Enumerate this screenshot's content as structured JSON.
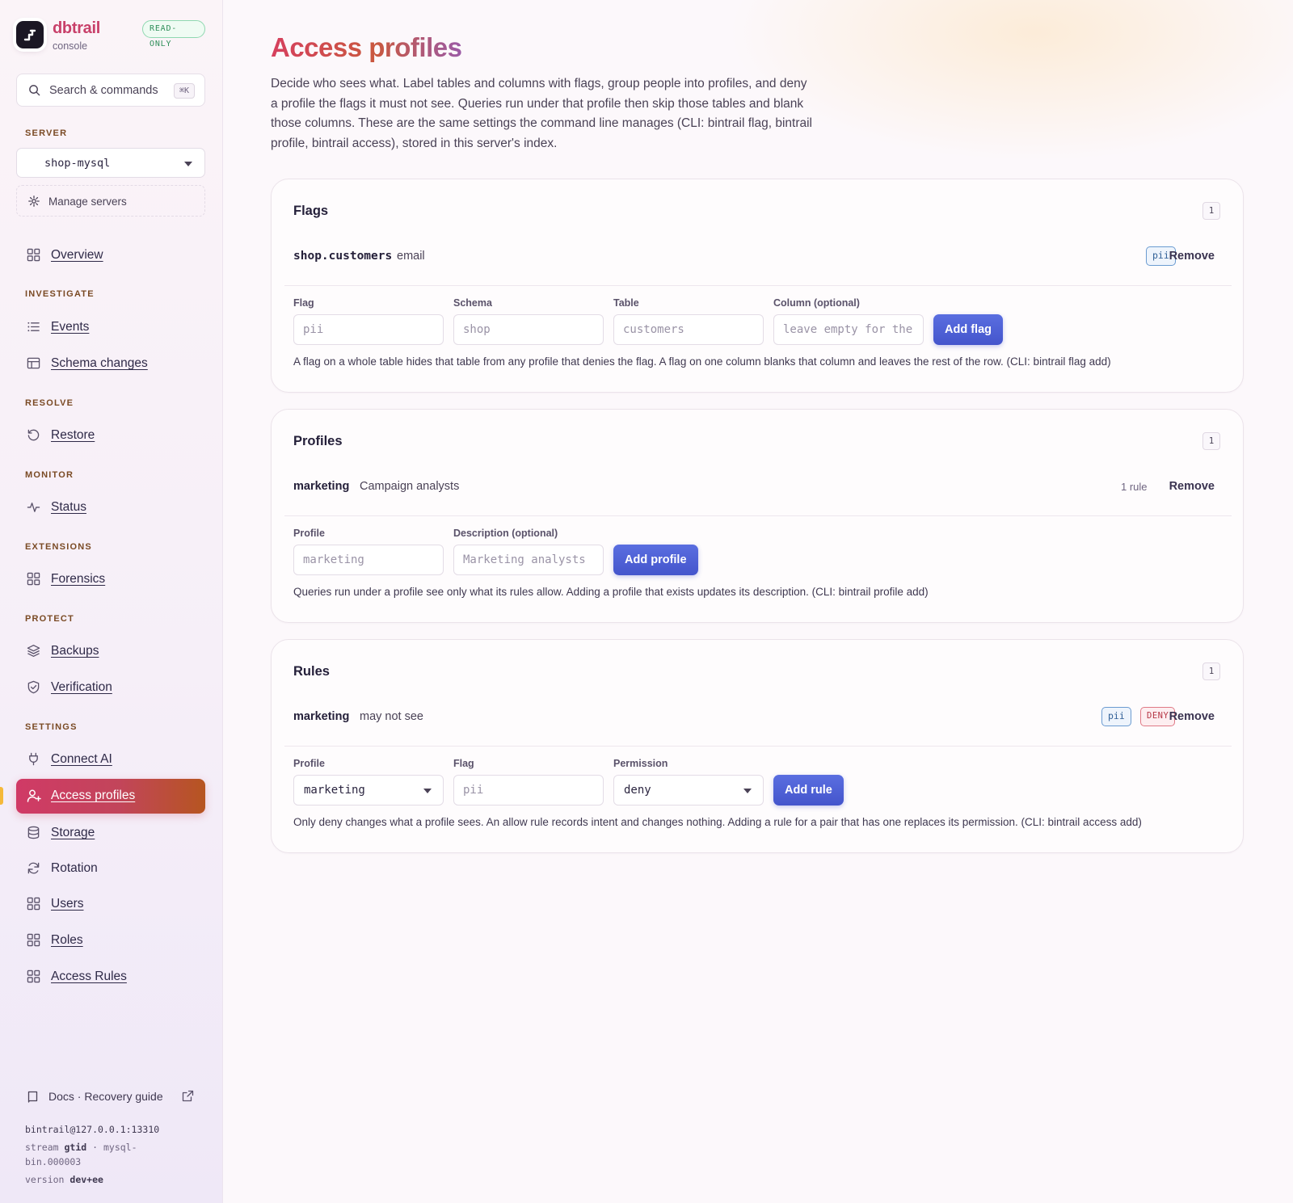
{
  "brand": {
    "name": "dbtrail",
    "subtitle": "console",
    "mode_badge": "READ-ONLY"
  },
  "search": {
    "label": "Search & commands",
    "shortcut": "⌘K"
  },
  "sidebar": {
    "server_section": "SERVER",
    "server_value": "shop-mysql",
    "manage_servers": "Manage servers",
    "overview": "Overview",
    "sections": {
      "investigate": "INVESTIGATE",
      "resolve": "RESOLVE",
      "monitor": "MONITOR",
      "extensions": "EXTENSIONS",
      "protect": "PROTECT",
      "settings": "SETTINGS"
    },
    "items": {
      "events": "Events",
      "schema_changes": "Schema changes",
      "restore": "Restore",
      "status": "Status",
      "forensics": "Forensics",
      "backups": "Backups",
      "verification": "Verification",
      "connect_ai": "Connect AI",
      "access_profiles": "Access profiles",
      "storage": "Storage",
      "rotation": "Rotation",
      "users": "Users",
      "roles": "Roles",
      "access_rules": "Access Rules"
    },
    "docs": "Docs · Recovery guide",
    "connection": {
      "address": "bintrail@127.0.0.1:13310",
      "stream_label": "stream",
      "stream_mode": "gtid",
      "stream_file_a": "· mysql-",
      "stream_file_b": "bin.000003",
      "version_label": "version",
      "version_value": "dev+ee"
    }
  },
  "page": {
    "title": "Access profiles",
    "intro": "Decide who sees what. Label tables and columns with flags, group people into profiles, and deny a profile the flags it must not see. Queries run under that profile then skip those tables and blank those columns. These are the same settings the command line manages (CLI: bintrail flag, bintrail profile, bintrail access), stored in this server's index."
  },
  "flags": {
    "title": "Flags",
    "count": "1",
    "entry": {
      "target": "shop.customers",
      "column": "email",
      "flag": "pii",
      "remove": "Remove"
    },
    "form": {
      "flag_label": "Flag",
      "flag_placeholder": "pii",
      "schema_label": "Schema",
      "schema_placeholder": "shop",
      "table_label": "Table",
      "table_placeholder": "customers",
      "column_label": "Column (optional)",
      "column_placeholder": "leave empty for the whole table",
      "submit": "Add flag"
    },
    "help": "A flag on a whole table hides that table from any profile that denies the flag. A flag on one column blanks that column and leaves the rest of the row. (CLI: bintrail flag add)"
  },
  "profiles": {
    "title": "Profiles",
    "count": "1",
    "entry": {
      "name": "marketing",
      "description": "Campaign analysts",
      "rules": "1 rule",
      "remove": "Remove"
    },
    "form": {
      "profile_label": "Profile",
      "profile_placeholder": "marketing",
      "description_label": "Description (optional)",
      "description_placeholder": "Marketing analysts",
      "submit": "Add profile"
    },
    "help": "Queries run under a profile see only what its rules allow. Adding a profile that exists updates its description. (CLI: bintrail profile add)"
  },
  "rules": {
    "title": "Rules",
    "count": "1",
    "entry": {
      "profile": "marketing",
      "text": "may not see",
      "flag": "pii",
      "permission": "DENY",
      "remove": "Remove"
    },
    "form": {
      "profile_label": "Profile",
      "profile_value": "marketing",
      "flag_label": "Flag",
      "flag_placeholder": "pii",
      "permission_label": "Permission",
      "permission_value": "deny",
      "submit": "Add rule"
    },
    "help": "Only deny changes what a profile sees. An allow rule records intent and changes nothing. Adding a rule for a pair that has one replaces its permission. (CLI: bintrail access add)"
  }
}
